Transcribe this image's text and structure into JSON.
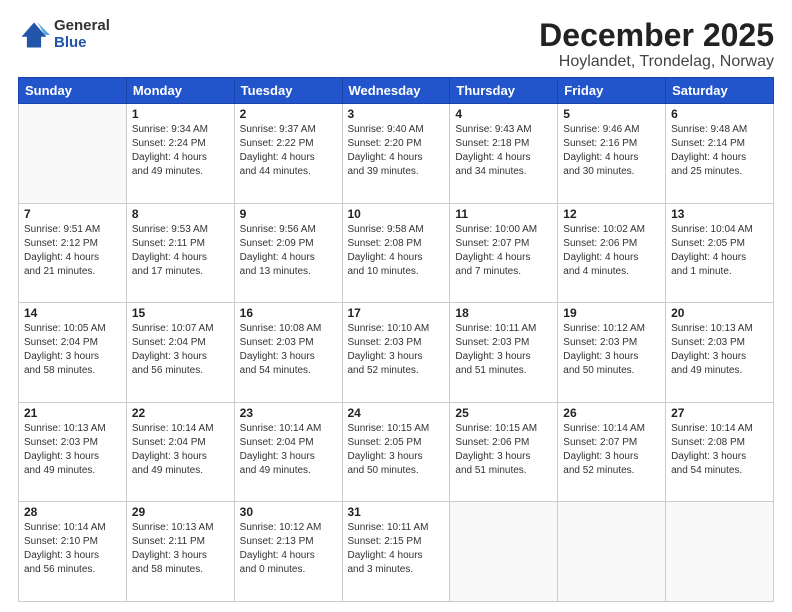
{
  "logo": {
    "general": "General",
    "blue": "Blue"
  },
  "title": "December 2025",
  "subtitle": "Hoylandet, Trondelag, Norway",
  "headers": [
    "Sunday",
    "Monday",
    "Tuesday",
    "Wednesday",
    "Thursday",
    "Friday",
    "Saturday"
  ],
  "weeks": [
    [
      {
        "day": "",
        "info": ""
      },
      {
        "day": "1",
        "info": "Sunrise: 9:34 AM\nSunset: 2:24 PM\nDaylight: 4 hours\nand 49 minutes."
      },
      {
        "day": "2",
        "info": "Sunrise: 9:37 AM\nSunset: 2:22 PM\nDaylight: 4 hours\nand 44 minutes."
      },
      {
        "day": "3",
        "info": "Sunrise: 9:40 AM\nSunset: 2:20 PM\nDaylight: 4 hours\nand 39 minutes."
      },
      {
        "day": "4",
        "info": "Sunrise: 9:43 AM\nSunset: 2:18 PM\nDaylight: 4 hours\nand 34 minutes."
      },
      {
        "day": "5",
        "info": "Sunrise: 9:46 AM\nSunset: 2:16 PM\nDaylight: 4 hours\nand 30 minutes."
      },
      {
        "day": "6",
        "info": "Sunrise: 9:48 AM\nSunset: 2:14 PM\nDaylight: 4 hours\nand 25 minutes."
      }
    ],
    [
      {
        "day": "7",
        "info": "Sunrise: 9:51 AM\nSunset: 2:12 PM\nDaylight: 4 hours\nand 21 minutes."
      },
      {
        "day": "8",
        "info": "Sunrise: 9:53 AM\nSunset: 2:11 PM\nDaylight: 4 hours\nand 17 minutes."
      },
      {
        "day": "9",
        "info": "Sunrise: 9:56 AM\nSunset: 2:09 PM\nDaylight: 4 hours\nand 13 minutes."
      },
      {
        "day": "10",
        "info": "Sunrise: 9:58 AM\nSunset: 2:08 PM\nDaylight: 4 hours\nand 10 minutes."
      },
      {
        "day": "11",
        "info": "Sunrise: 10:00 AM\nSunset: 2:07 PM\nDaylight: 4 hours\nand 7 minutes."
      },
      {
        "day": "12",
        "info": "Sunrise: 10:02 AM\nSunset: 2:06 PM\nDaylight: 4 hours\nand 4 minutes."
      },
      {
        "day": "13",
        "info": "Sunrise: 10:04 AM\nSunset: 2:05 PM\nDaylight: 4 hours\nand 1 minute."
      }
    ],
    [
      {
        "day": "14",
        "info": "Sunrise: 10:05 AM\nSunset: 2:04 PM\nDaylight: 3 hours\nand 58 minutes."
      },
      {
        "day": "15",
        "info": "Sunrise: 10:07 AM\nSunset: 2:04 PM\nDaylight: 3 hours\nand 56 minutes."
      },
      {
        "day": "16",
        "info": "Sunrise: 10:08 AM\nSunset: 2:03 PM\nDaylight: 3 hours\nand 54 minutes."
      },
      {
        "day": "17",
        "info": "Sunrise: 10:10 AM\nSunset: 2:03 PM\nDaylight: 3 hours\nand 52 minutes."
      },
      {
        "day": "18",
        "info": "Sunrise: 10:11 AM\nSunset: 2:03 PM\nDaylight: 3 hours\nand 51 minutes."
      },
      {
        "day": "19",
        "info": "Sunrise: 10:12 AM\nSunset: 2:03 PM\nDaylight: 3 hours\nand 50 minutes."
      },
      {
        "day": "20",
        "info": "Sunrise: 10:13 AM\nSunset: 2:03 PM\nDaylight: 3 hours\nand 49 minutes."
      }
    ],
    [
      {
        "day": "21",
        "info": "Sunrise: 10:13 AM\nSunset: 2:03 PM\nDaylight: 3 hours\nand 49 minutes."
      },
      {
        "day": "22",
        "info": "Sunrise: 10:14 AM\nSunset: 2:04 PM\nDaylight: 3 hours\nand 49 minutes."
      },
      {
        "day": "23",
        "info": "Sunrise: 10:14 AM\nSunset: 2:04 PM\nDaylight: 3 hours\nand 49 minutes."
      },
      {
        "day": "24",
        "info": "Sunrise: 10:15 AM\nSunset: 2:05 PM\nDaylight: 3 hours\nand 50 minutes."
      },
      {
        "day": "25",
        "info": "Sunrise: 10:15 AM\nSunset: 2:06 PM\nDaylight: 3 hours\nand 51 minutes."
      },
      {
        "day": "26",
        "info": "Sunrise: 10:14 AM\nSunset: 2:07 PM\nDaylight: 3 hours\nand 52 minutes."
      },
      {
        "day": "27",
        "info": "Sunrise: 10:14 AM\nSunset: 2:08 PM\nDaylight: 3 hours\nand 54 minutes."
      }
    ],
    [
      {
        "day": "28",
        "info": "Sunrise: 10:14 AM\nSunset: 2:10 PM\nDaylight: 3 hours\nand 56 minutes."
      },
      {
        "day": "29",
        "info": "Sunrise: 10:13 AM\nSunset: 2:11 PM\nDaylight: 3 hours\nand 58 minutes."
      },
      {
        "day": "30",
        "info": "Sunrise: 10:12 AM\nSunset: 2:13 PM\nDaylight: 4 hours\nand 0 minutes."
      },
      {
        "day": "31",
        "info": "Sunrise: 10:11 AM\nSunset: 2:15 PM\nDaylight: 4 hours\nand 3 minutes."
      },
      {
        "day": "",
        "info": ""
      },
      {
        "day": "",
        "info": ""
      },
      {
        "day": "",
        "info": ""
      }
    ]
  ]
}
